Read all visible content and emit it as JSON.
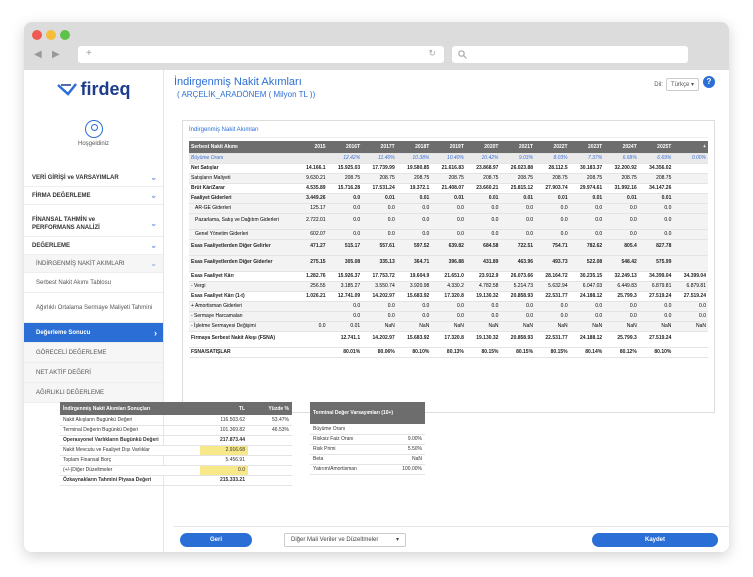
{
  "app": {
    "logo_text": "firdeq",
    "greeting": "Hoşgeldiniz",
    "title": "İndirgenmiş Nakit Akımları",
    "subtitle": "( ARÇELİK_ARADÖNEM ( Milyon TL ))",
    "lang_label": "Dil:",
    "lang_value": "Türkçe",
    "help": "?"
  },
  "sidebar": {
    "sections": [
      {
        "label": "VERİ GİRİŞİ ve VARSAYIMLAR",
        "chev": "⌄"
      },
      {
        "label": "FİRMA DEĞERLEME",
        "chev": "⌄"
      }
    ],
    "sub_title_1": "FİNANSAL TAHMİN ve",
    "sub_title_2": "PERFORMANS ANALİZİ",
    "deg_title": "DEĞERLEME",
    "items": [
      {
        "label": "İNDİRGENMİŞ NAKİT AKIMLARI",
        "chev": "⌄"
      },
      {
        "label": "Serbest Nakit Akımı Tablosu"
      },
      {
        "label": "Ağırlıklı Ortalama Sermaye Maliyeti Tahmini"
      },
      {
        "label": "Değerleme Sonucu",
        "chev": "›"
      },
      {
        "label": "GÖRECELİ DEĞERLEME"
      },
      {
        "label": "NET AKTİF DEĞERİ"
      },
      {
        "label": "AĞIRLIKLI DEĞERLEME"
      }
    ]
  },
  "fcf": {
    "card_title": "İndirgenmiş Nakit Akımları",
    "headers": [
      "Serbest Nakit Akımı",
      "2015",
      "2016T",
      "2017T",
      "2018T",
      "2019T",
      "2020T",
      "2021T",
      "2022T",
      "2023T",
      "2024T",
      "2025T",
      "+"
    ],
    "rows": [
      [
        "Büyüme Oranı",
        "",
        "12.42%",
        "11.40%",
        "10.38%",
        "10.40%",
        "10.42%",
        "9.03%",
        "8.03%",
        "7.37%",
        "6.68%",
        "6.69%",
        "0.00%"
      ],
      [
        "Net Satışlar",
        "14.166.1",
        "15.925.03",
        "17.739.99",
        "19.580.85",
        "21.616.83",
        "23.868.97",
        "26.023.88",
        "28.112.5",
        "30.183.37",
        "32.200.92",
        "34.356.02",
        ""
      ],
      [
        "Satışların Maliyeti",
        "9.630.21",
        "208.75",
        "208.75",
        "208.75",
        "208.75",
        "208.75",
        "208.75",
        "208.75",
        "208.75",
        "208.75",
        "208.75",
        ""
      ],
      [
        "Brüt Kâr/Zarar",
        "4.535.89",
        "15.716.28",
        "17.531.24",
        "19.372.1",
        "21.408.07",
        "23.660.21",
        "25.815.12",
        "27.903.74",
        "29.974.61",
        "31.992.16",
        "34.147.26",
        ""
      ],
      [
        "Faaliyet Giderleri",
        "3.449.26",
        "0.0",
        "0.01",
        "0.01",
        "0.01",
        "0.01",
        "0.01",
        "0.01",
        "0.01",
        "0.01",
        "0.01",
        ""
      ],
      [
        "AR-GE Giderleri",
        "125.17",
        "0.0",
        "0.0",
        "0.0",
        "0.0",
        "0.0",
        "0.0",
        "0.0",
        "0.0",
        "0.0",
        "0.0",
        ""
      ],
      [
        "Pazarlama, Satış ve Dağıtım Giderleri",
        "2.722.01",
        "0.0",
        "0.0",
        "0.0",
        "0.0",
        "0.0",
        "0.0",
        "0.0",
        "0.0",
        "0.0",
        "0.0",
        ""
      ],
      [
        "Genel Yönetim Giderleri",
        "602.07",
        "0.0",
        "0.0",
        "0.0",
        "0.0",
        "0.0",
        "0.0",
        "0.0",
        "0.0",
        "0.0",
        "0.0",
        ""
      ],
      [
        "Esas Faaliyetlerden Diğer Gelirler",
        "471.27",
        "515.17",
        "557.61",
        "597.52",
        "639.82",
        "684.58",
        "722.51",
        "754.71",
        "782.62",
        "805.4",
        "827.78",
        ""
      ],
      [
        "Esas Faaliyetlerden Diğer Giderler",
        "275.15",
        "305.08",
        "335.13",
        "364.71",
        "396.88",
        "431.89",
        "463.96",
        "493.73",
        "522.08",
        "548.42",
        "575.99",
        ""
      ],
      [
        "Esas Faaliyet Kârı",
        "1.282.76",
        "15.926.37",
        "17.753.72",
        "19.604.9",
        "21.651.0",
        "23.912.9",
        "26.073.66",
        "28.164.72",
        "30.235.15",
        "32.249.13",
        "34.399.04",
        "34.399.04"
      ],
      [
        "- Vergi",
        "256.55",
        "3.185.27",
        "3.550.74",
        "3.920.98",
        "4.330.2",
        "4.782.58",
        "5.214.73",
        "5.632.94",
        "6.047.03",
        "6.449.83",
        "6.879.81",
        "6.879.81"
      ],
      [
        "Esas Faaliyet Kârı (1-t)",
        "1.026.21",
        "12.741.09",
        "14.202.97",
        "15.683.92",
        "17.320.8",
        "19.130.32",
        "20.858.93",
        "22.531.77",
        "24.188.12",
        "25.799.3",
        "27.519.24",
        "27.519.24"
      ],
      [
        "+ Amortisman Giderleri",
        "",
        "0.0",
        "0.0",
        "0.0",
        "0.0",
        "0.0",
        "0.0",
        "0.0",
        "0.0",
        "0.0",
        "0.0",
        "0.0"
      ],
      [
        "- Sermaye Harcamaları",
        "",
        "0.0",
        "0.0",
        "0.0",
        "0.0",
        "0.0",
        "0.0",
        "0.0",
        "0.0",
        "0.0",
        "0.0",
        "0.0"
      ],
      [
        "- İşletme Sermayesi Değişimi",
        "0.0",
        "0.01",
        "NaN",
        "NaN",
        "NaN",
        "NaN",
        "NaN",
        "NaN",
        "NaN",
        "NaN",
        "NaN",
        "NaN"
      ],
      [
        "Firmaya Serbest Nakit Akışı (FSNA)",
        "",
        "12.741.1",
        "14.202.97",
        "15.683.92",
        "17.320.8",
        "19.130.32",
        "20.858.93",
        "22.531.77",
        "24.188.12",
        "25.799.3",
        "27.519.24",
        ""
      ],
      [
        "FSNA/SATIŞLAR",
        "",
        "80.01%",
        "80.06%",
        "80.10%",
        "80.13%",
        "80.15%",
        "80.15%",
        "80.15%",
        "80.14%",
        "80.12%",
        "80.10%",
        ""
      ]
    ]
  },
  "results": {
    "headers": [
      "İndirgenmiş Nakit Akımları Sonuçları",
      "TL",
      "Yüzde %"
    ],
    "rows": [
      [
        "Nakit Akışların Bugünkü Değeri",
        "116.503.62",
        "53.47%"
      ],
      [
        "Terminal Değerin Bugünkü Değeri",
        "101.369.82",
        "46.53%"
      ],
      [
        "Operasyonel Varlıkların Bugünkü Değeri",
        "217.873.44",
        ""
      ],
      [
        "Nakit Mevcutu ve Faaliyet Dışı Varlıklar",
        "2.916.68",
        ""
      ],
      [
        "Toplam Finansal Borç",
        "5.456.91",
        ""
      ],
      [
        "(+/-)Diğer Düzeltmeler",
        "0.0",
        ""
      ],
      [
        "Özkaynakların Tahmini Piyasa Değeri",
        "215.333.21",
        ""
      ]
    ]
  },
  "terminal": {
    "header": "Terminal Değer Varsayımları (10+)",
    "rows": [
      [
        "Büyüme Oranı",
        ""
      ],
      [
        "Risksiz Faiz Oranı",
        "9.00%"
      ],
      [
        "Risk Primi",
        "5.50%"
      ],
      [
        "Beta",
        "NaN"
      ],
      [
        "Yatırım/Amortisman",
        "100.00%"
      ]
    ]
  },
  "footer": {
    "back": "Geri",
    "select": "Diğer Mali Veriler ve Düzeltmeler",
    "save": "Kaydet"
  },
  "colors": {
    "accent": "#2b6fd6",
    "header_gray": "#6d6d6d",
    "highlight": "#f7e98a"
  }
}
